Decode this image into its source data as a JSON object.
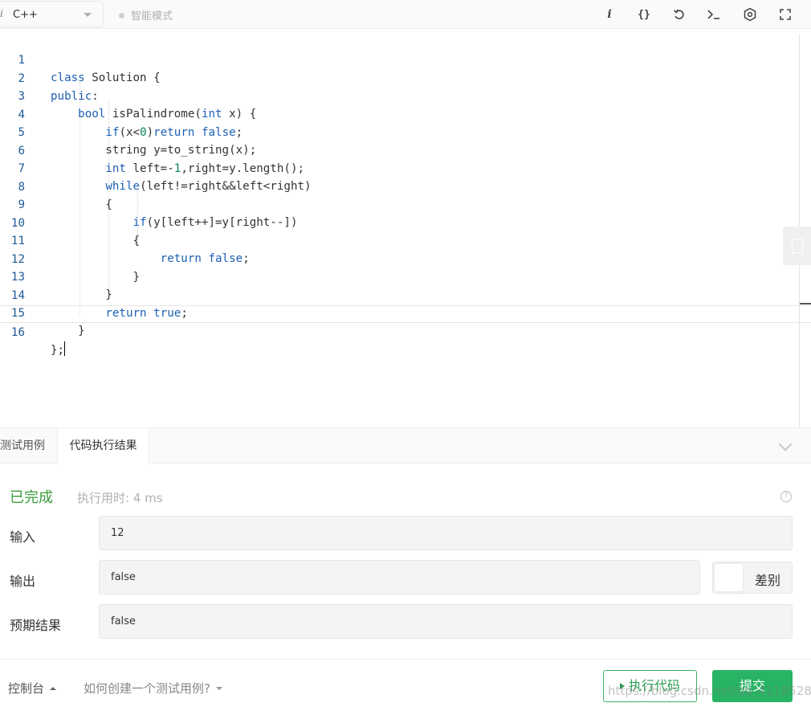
{
  "toolbar": {
    "language": "C++",
    "mode": "智能模式",
    "icons": [
      "info-icon",
      "format-icon",
      "reset-icon",
      "terminal-icon",
      "settings-icon",
      "fullscreen-icon"
    ]
  },
  "editor": {
    "lines": [
      {
        "no": "1",
        "code": "class Solution {"
      },
      {
        "no": "2",
        "code": "public:"
      },
      {
        "no": "3",
        "code": "    bool isPalindrome(int x) {"
      },
      {
        "no": "4",
        "code": "        if(x<0)return false;"
      },
      {
        "no": "5",
        "code": "        string y=to_string(x);"
      },
      {
        "no": "6",
        "code": "        int left=-1,right=y.length();"
      },
      {
        "no": "7",
        "code": "        while(left!=right&&left<right)"
      },
      {
        "no": "8",
        "code": "        {"
      },
      {
        "no": "9",
        "code": "            if(y[left++]=y[right--])"
      },
      {
        "no": "10",
        "code": "            {"
      },
      {
        "no": "11",
        "code": "                return false;"
      },
      {
        "no": "12",
        "code": "            }"
      },
      {
        "no": "13",
        "code": "        }"
      },
      {
        "no": "14",
        "code": "        return true;"
      },
      {
        "no": "15",
        "code": "    }"
      },
      {
        "no": "16",
        "code": "};"
      }
    ],
    "active_line": 16
  },
  "tabs": {
    "test_cases": "测试用例",
    "result": "代码执行结果"
  },
  "result": {
    "status": "已完成",
    "runtime": "执行用时: 4 ms",
    "input_label": "输入",
    "input_value": "12",
    "output_label": "输出",
    "output_value": "false",
    "expected_label": "预期结果",
    "expected_value": "false",
    "diff_label": "差别"
  },
  "footer": {
    "console": "控制台",
    "howto": "如何创建一个测试用例?",
    "run": "执行代码",
    "submit": "提交",
    "watermark": "https://blog.csdn.net/qq_41185288"
  },
  "colors": {
    "accent_green": "#28b464",
    "status_green": "#3c9c3c",
    "keyword_blue": "#1c5fb5"
  }
}
